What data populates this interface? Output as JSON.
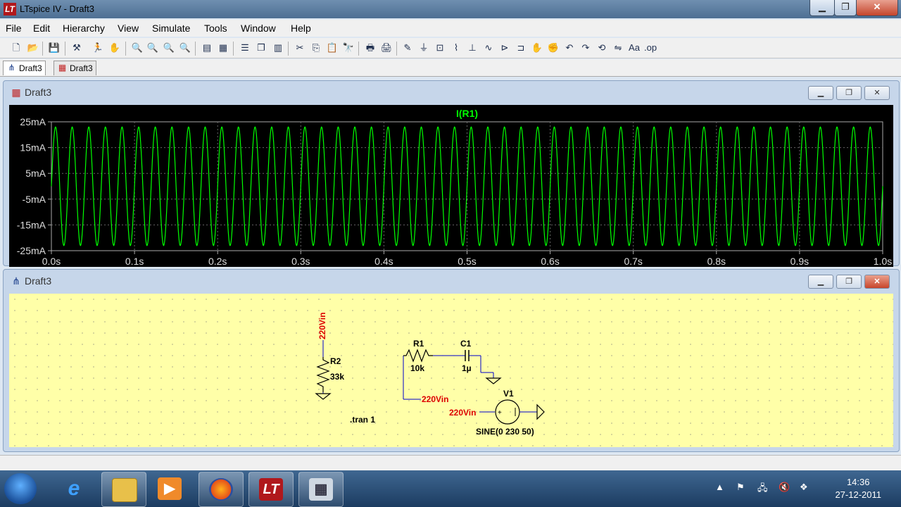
{
  "window": {
    "title": "LTspice IV - Draft3",
    "app_icon": "ltspice-logo-icon"
  },
  "menu": [
    "File",
    "Edit",
    "Hierarchy",
    "View",
    "Simulate",
    "Tools",
    "Window",
    "Help"
  ],
  "tabs": [
    {
      "label": "Draft3",
      "icon": "schematic-icon",
      "active": true
    },
    {
      "label": "Draft3",
      "icon": "waveform-icon",
      "active": false
    }
  ],
  "plot_window": {
    "title": "Draft3",
    "trace_label": "I(R1)",
    "trace_color": "#00ff00",
    "chart_data": {
      "type": "line",
      "title": "I(R1)",
      "xlabel": "",
      "ylabel": "",
      "x_ticks": [
        "0.0s",
        "0.1s",
        "0.2s",
        "0.3s",
        "0.4s",
        "0.5s",
        "0.6s",
        "0.7s",
        "0.8s",
        "0.9s",
        "1.0s"
      ],
      "y_ticks": [
        "25mA",
        "15mA",
        "5mA",
        "-5mA",
        "-15mA",
        "-25mA"
      ],
      "xlim": [
        0,
        1
      ],
      "ylim": [
        -25,
        25
      ],
      "grid": true,
      "series": [
        {
          "name": "I(R1)",
          "waveform": "sine",
          "frequency_hz": 50,
          "amplitude_ma": 23,
          "offset_ma": 0,
          "color": "#00ff00"
        }
      ]
    }
  },
  "schematic_window": {
    "title": "Draft3",
    "labels": {
      "net_top": "220Vin",
      "r2_name": "R2",
      "r2_value": "33k",
      "r1_name": "R1",
      "r1_value": "10k",
      "c1_name": "C1",
      "c1_value": "1µ",
      "net_mid": "220Vin",
      "v1_name": "V1",
      "v1_net": "220Vin",
      "v1_value": "SINE(0 230 50)",
      "directive": ".tran 1"
    },
    "colors": {
      "background": "#ffffa8",
      "wire": "#0000cc",
      "net_label": "#dd0000"
    }
  },
  "taskbar": {
    "apps": [
      "internet-explorer-icon",
      "file-explorer-icon",
      "media-player-icon",
      "firefox-icon",
      "ltspice-icon",
      "calculator-icon"
    ],
    "clock_time": "14:36",
    "clock_date": "27-12-2011"
  }
}
